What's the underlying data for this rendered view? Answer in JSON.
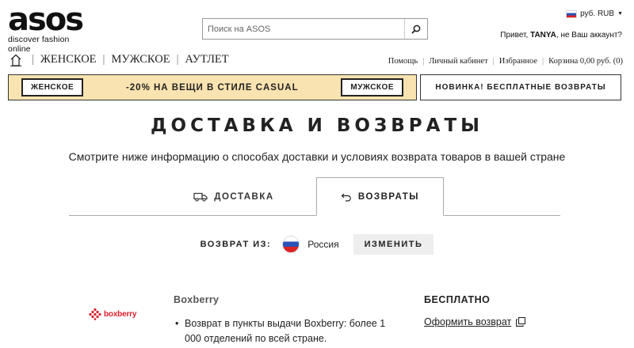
{
  "header": {
    "logo_word": "asos",
    "logo_tagline": "discover fashion online",
    "search_placeholder": "Поиск на ASOS",
    "currency": "руб. RUB",
    "greeting_prefix": "Привет, ",
    "greeting_name": "TANYA",
    "greeting_suffix": ", не Ваш аккаунт?"
  },
  "nav": {
    "main": [
      "ЖЕНСКОЕ",
      "МУЖСКОЕ",
      "АУТЛЕТ"
    ],
    "right": [
      "Помощь",
      "Личный кабинет",
      "Избранное",
      "Корзина 0,00 руб. (0)"
    ]
  },
  "promo": {
    "left_button": "ЖЕНСКОЕ",
    "text": "-20% НА ВЕЩИ В СТИЛЕ CASUAL",
    "right_button": "МУЖСКОЕ",
    "banner": "НОВИНКА! БЕСПЛАТНЫЕ ВОЗВРАТЫ",
    "bg_color": "#f9e3b0"
  },
  "page": {
    "title": "ДОСТАВКА И ВОЗВРАТЫ",
    "subtitle": "Смотрите ниже информацию о способах доставки и условиях возврата товаров в вашей стране"
  },
  "tabs": {
    "delivery": "ДОСТАВКА",
    "returns": "ВОЗВРАТЫ",
    "active": "returns"
  },
  "return_from": {
    "label": "ВОЗВРАТ ИЗ:",
    "country": "Россия",
    "change_button": "ИЗМЕНИТЬ"
  },
  "carrier": {
    "logo_text": "boxberry",
    "name": "Boxberry",
    "details": [
      "Возврат в пункты выдачи Boxberry: более 1 000 отделений по всей стране."
    ],
    "price": "БЕСПЛАТНО",
    "action_link": "Оформить возврат",
    "brand_color": "#d8202e"
  }
}
